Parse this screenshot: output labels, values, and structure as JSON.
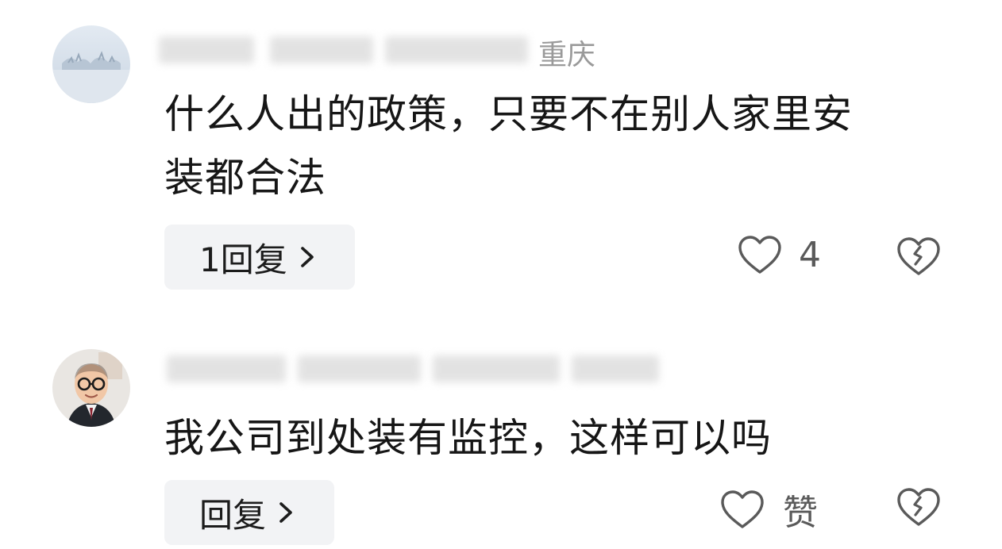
{
  "comments": [
    {
      "author_location": "重庆",
      "text_line1": "什么人出的政策，只要不在别人家里安",
      "text_line2": "装都合法",
      "reply_label": "1回复",
      "like_count": "4"
    },
    {
      "text_line1": "我公司到处装有监控，这样可以吗",
      "reply_label": "回复",
      "like_label": "赞"
    }
  ],
  "icons": {
    "like": "heart-outline-icon",
    "dislike": "broken-heart-icon",
    "reply_arrow": "chevron-right-icon"
  },
  "colors": {
    "reply_bg": "#f2f3f5",
    "icon_stroke": "#5a5a5a",
    "text": "#161616",
    "meta_gray": "#9a9a9a"
  }
}
